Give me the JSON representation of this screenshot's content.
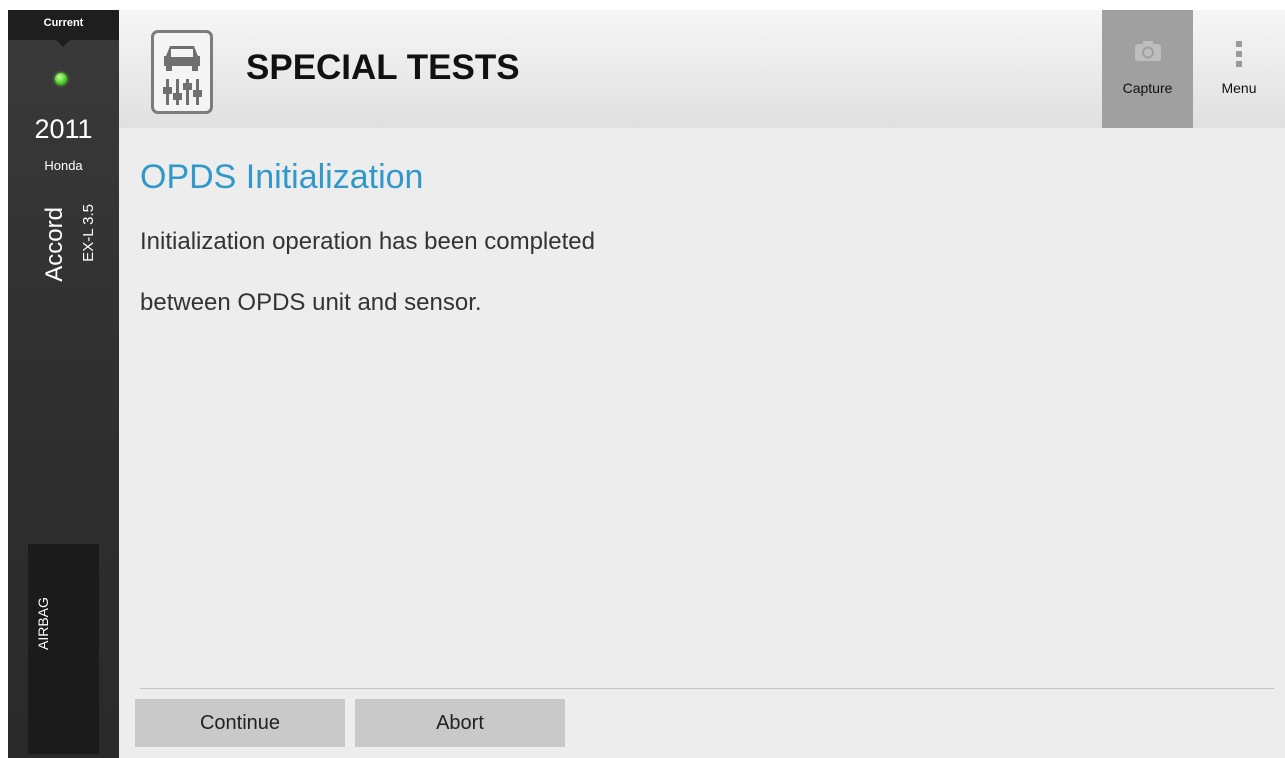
{
  "sidebar": {
    "tab_label": "Current",
    "status_color": "#4fcf2a",
    "year": "2011",
    "make": "Honda",
    "model": "Accord",
    "trim": "EX-L 3.5",
    "system": "AIRBAG"
  },
  "header": {
    "icon": "car-lift-icon",
    "title": "SPECIAL TESTS",
    "capture_label": "Capture",
    "capture_icon": "camera-icon",
    "menu_label": "Menu",
    "menu_icon": "vertical-dots-icon"
  },
  "main": {
    "title": "OPDS Initialization",
    "message_line1": "Initialization operation has been completed",
    "message_line2": "between OPDS unit and sensor.",
    "title_color": "#3199c9"
  },
  "actions": {
    "continue_label": "Continue",
    "abort_label": "Abort"
  }
}
